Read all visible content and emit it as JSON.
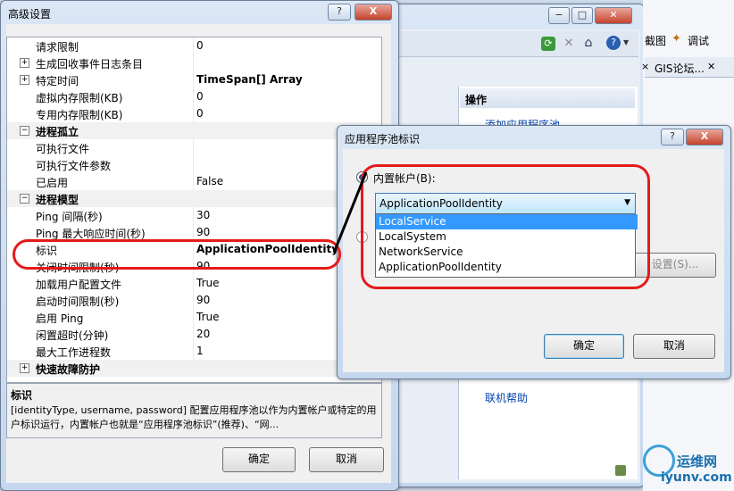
{
  "advanced": {
    "title": "高级设置",
    "help_btn": "?",
    "close_btn": "X",
    "rows": [
      {
        "label": "请求限制",
        "value": "0",
        "type": "prop"
      },
      {
        "label": "生成回收事件日志条目",
        "value": "",
        "type": "prop",
        "exp": "+"
      },
      {
        "label": "特定时间",
        "value": "TimeSpan[] Array",
        "type": "prop",
        "exp": "+",
        "bold": true
      },
      {
        "label": "虚拟内存限制(KB)",
        "value": "0",
        "type": "prop"
      },
      {
        "label": "专用内存限制(KB)",
        "value": "0",
        "type": "prop"
      },
      {
        "label": "进程孤立",
        "value": "",
        "type": "cat",
        "exp": "−"
      },
      {
        "label": "可执行文件",
        "value": "",
        "type": "prop"
      },
      {
        "label": "可执行文件参数",
        "value": "",
        "type": "prop"
      },
      {
        "label": "已启用",
        "value": "False",
        "type": "prop"
      },
      {
        "label": "进程模型",
        "value": "",
        "type": "cat",
        "exp": "−"
      },
      {
        "label": "Ping 间隔(秒)",
        "value": "30",
        "type": "prop"
      },
      {
        "label": "Ping 最大响应时间(秒)",
        "value": "90",
        "type": "prop"
      },
      {
        "label": "标识",
        "value": "ApplicationPoolIdentity",
        "type": "prop",
        "bold": true
      },
      {
        "label": "关闭时间限制(秒)",
        "value": "90",
        "type": "prop"
      },
      {
        "label": "加载用户配置文件",
        "value": "True",
        "type": "prop"
      },
      {
        "label": "启动时间限制(秒)",
        "value": "90",
        "type": "prop"
      },
      {
        "label": "启用 Ping",
        "value": "True",
        "type": "prop"
      },
      {
        "label": "闲置超时(分钟)",
        "value": "20",
        "type": "prop"
      },
      {
        "label": "最大工作进程数",
        "value": "1",
        "type": "prop"
      },
      {
        "label": "快速故障防护",
        "value": "",
        "type": "cat",
        "exp": "+"
      }
    ],
    "desc_title": "标识",
    "desc_text": "[identityType, username, password] 配置应用程序池以作为内置帐户或特定的用户标识运行，内置帐户也就是“应用程序池标识”(推荐)、“网...",
    "ok": "确定",
    "cancel": "取消"
  },
  "background": {
    "toolbar_right": [
      "截图",
      "调试"
    ],
    "tab": "GIS论坛...",
    "actions_header": "操作",
    "action_add": "添加应用程序池...",
    "online_help": "联机帮助",
    "watermark_cn": "运维网",
    "watermark_url": "iyunv.com"
  },
  "identity": {
    "title": "应用程序池标识",
    "help_btn": "?",
    "close_btn": "X",
    "builtin_label": "内置帐户(B):",
    "selected": "ApplicationPoolIdentity",
    "options": [
      "LocalService",
      "LocalSystem",
      "NetworkService",
      "ApplicationPoolIdentity"
    ],
    "highlighted_index": 0,
    "set_button": "设置(S)...",
    "ok": "确定",
    "cancel": "取消"
  }
}
